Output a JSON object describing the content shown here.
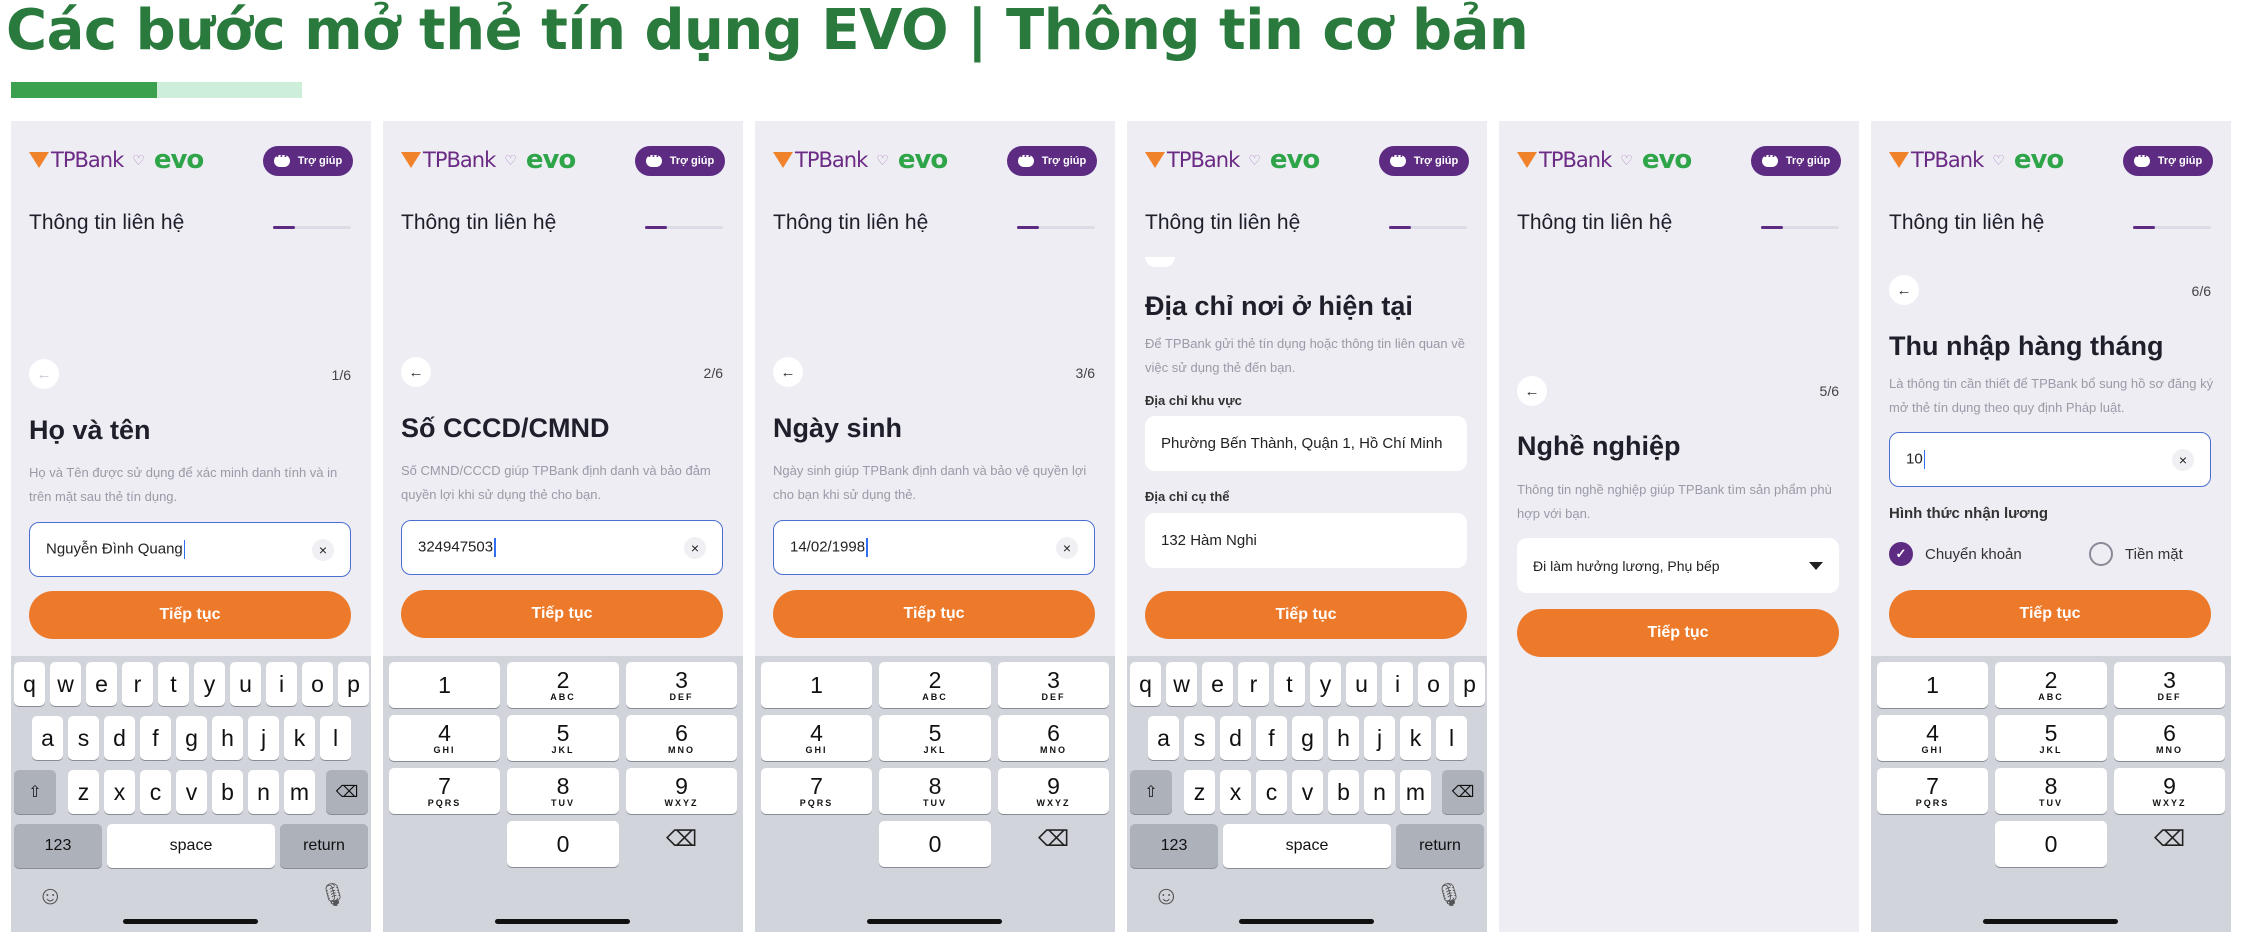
{
  "title": "Các bước mở thẻ tín dụng EVO | Thông tin cơ bản",
  "colors": {
    "title": "#2a7a3e",
    "accent": "#5d2b82",
    "cta": "#ec7a2a",
    "evo": "#2fa54a",
    "tpbank_orange": "#f08229"
  },
  "title_bar": {
    "progress_percent": 50
  },
  "common": {
    "brand_tp": "TPBank",
    "brand_heart": "♡",
    "brand_evo": "evo",
    "help": "Trợ giúp",
    "section": "Thông tin liên hệ",
    "cta": "Tiếp tục",
    "back_glyph": "←",
    "clear_glyph": "×"
  },
  "screens": [
    {
      "step": "1/6",
      "title": "Họ và tên",
      "desc": "Họ và Tên được sử dụng để xác minh danh tính và in trên mặt sau thẻ tín dụng.",
      "value": "Nguyễn Đình Quang",
      "keyboard": "alpha"
    },
    {
      "step": "2/6",
      "title": "Số CCCD/CMND",
      "desc": "Số CMND/CCCD giúp TPBank định danh và bảo đảm quyền lợi khi sử dụng thẻ cho bạn.",
      "value": "324947503",
      "keyboard": "numeric"
    },
    {
      "step": "3/6",
      "title": "Ngày sinh",
      "desc": "Ngày sinh giúp TPBank định danh và bảo vệ quyền lợi cho bạn khi sử dụng thẻ.",
      "value": "14/02/1998",
      "keyboard": "numeric"
    },
    {
      "title": "Địa chỉ nơi ở hiện tại",
      "desc": "Để TPBank gửi thẻ tín dụng hoặc thông tin liên quan về việc sử dụng thẻ đến bạn.",
      "area_label": "Địa chỉ khu vực",
      "area_value": "Phường Bến Thành, Quận 1, Hồ Chí Minh",
      "detail_label": "Địa chỉ cụ thể",
      "detail_value": "132 Hàm Nghi",
      "keyboard": "alpha"
    },
    {
      "step": "5/6",
      "title": "Nghề nghiệp",
      "desc": "Thông tin nghề nghiệp giúp TPBank tìm sản phẩm phù hợp với bạn.",
      "value": "Đi làm hưởng lương, Phụ bếp"
    },
    {
      "step": "6/6",
      "title": "Thu nhập hàng tháng",
      "desc": "Là thông tin cần thiết để TPBank bổ sung hồ sơ đăng ký mở thẻ tín dụng theo quy định Pháp luật.",
      "value": "10",
      "salary_label": "Hình thức nhận lương",
      "opt1": "Chuyển khoản",
      "opt2": "Tiền mặt",
      "opt1_checked": true,
      "keyboard": "numeric"
    }
  ],
  "alpha_keyboard": {
    "row1": [
      "q",
      "w",
      "e",
      "r",
      "t",
      "y",
      "u",
      "i",
      "o",
      "p"
    ],
    "row2": [
      "a",
      "s",
      "d",
      "f",
      "g",
      "h",
      "j",
      "k",
      "l"
    ],
    "row3": [
      "z",
      "x",
      "c",
      "v",
      "b",
      "n",
      "m"
    ],
    "shift_glyph": "⇧",
    "delete_glyph": "⌫",
    "numbers": "123",
    "space": "space",
    "return": "return",
    "emoji_glyph": "☺",
    "mic_glyph": "🎙"
  },
  "numeric_keyboard": {
    "keys": [
      {
        "n": "1",
        "l": ""
      },
      {
        "n": "2",
        "l": "ABC"
      },
      {
        "n": "3",
        "l": "DEF"
      },
      {
        "n": "4",
        "l": "GHI"
      },
      {
        "n": "5",
        "l": "JKL"
      },
      {
        "n": "6",
        "l": "MNO"
      },
      {
        "n": "7",
        "l": "PQRS"
      },
      {
        "n": "8",
        "l": "TUV"
      },
      {
        "n": "9",
        "l": "WXYZ"
      },
      {
        "n": "0",
        "l": ""
      }
    ],
    "delete_glyph": "⌫"
  }
}
